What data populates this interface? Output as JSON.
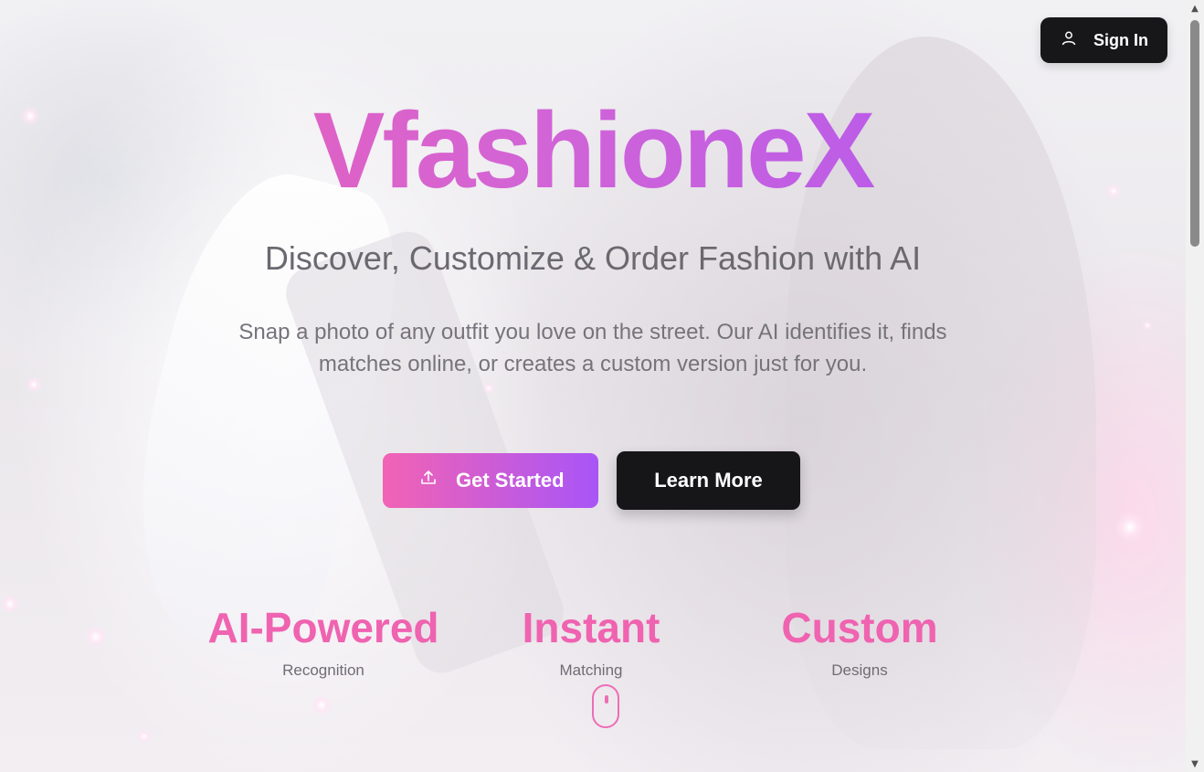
{
  "header": {
    "signin_label": "Sign In",
    "signin_icon": "user-icon"
  },
  "hero": {
    "brand": "VfashioneX",
    "tagline": "Discover, Customize & Order Fashion with AI",
    "description": "Snap a photo of any outfit you love on the street. Our AI identifies it, finds matches online, or creates a custom version just for you."
  },
  "actions": {
    "get_started_label": "Get Started",
    "get_started_icon": "upload-icon",
    "learn_more_label": "Learn More"
  },
  "stats": [
    {
      "value": "AI-Powered",
      "label": "Recognition"
    },
    {
      "value": "Instant",
      "label": "Matching"
    },
    {
      "value": "Custom",
      "label": "Designs"
    }
  ],
  "scroll_indicator_icon": "mouse-scroll-icon",
  "colors": {
    "gradient_start": "#f05fae",
    "gradient_end": "#a855f7",
    "dark_button": "#17171a",
    "stat_pink": "#ef63b0"
  }
}
